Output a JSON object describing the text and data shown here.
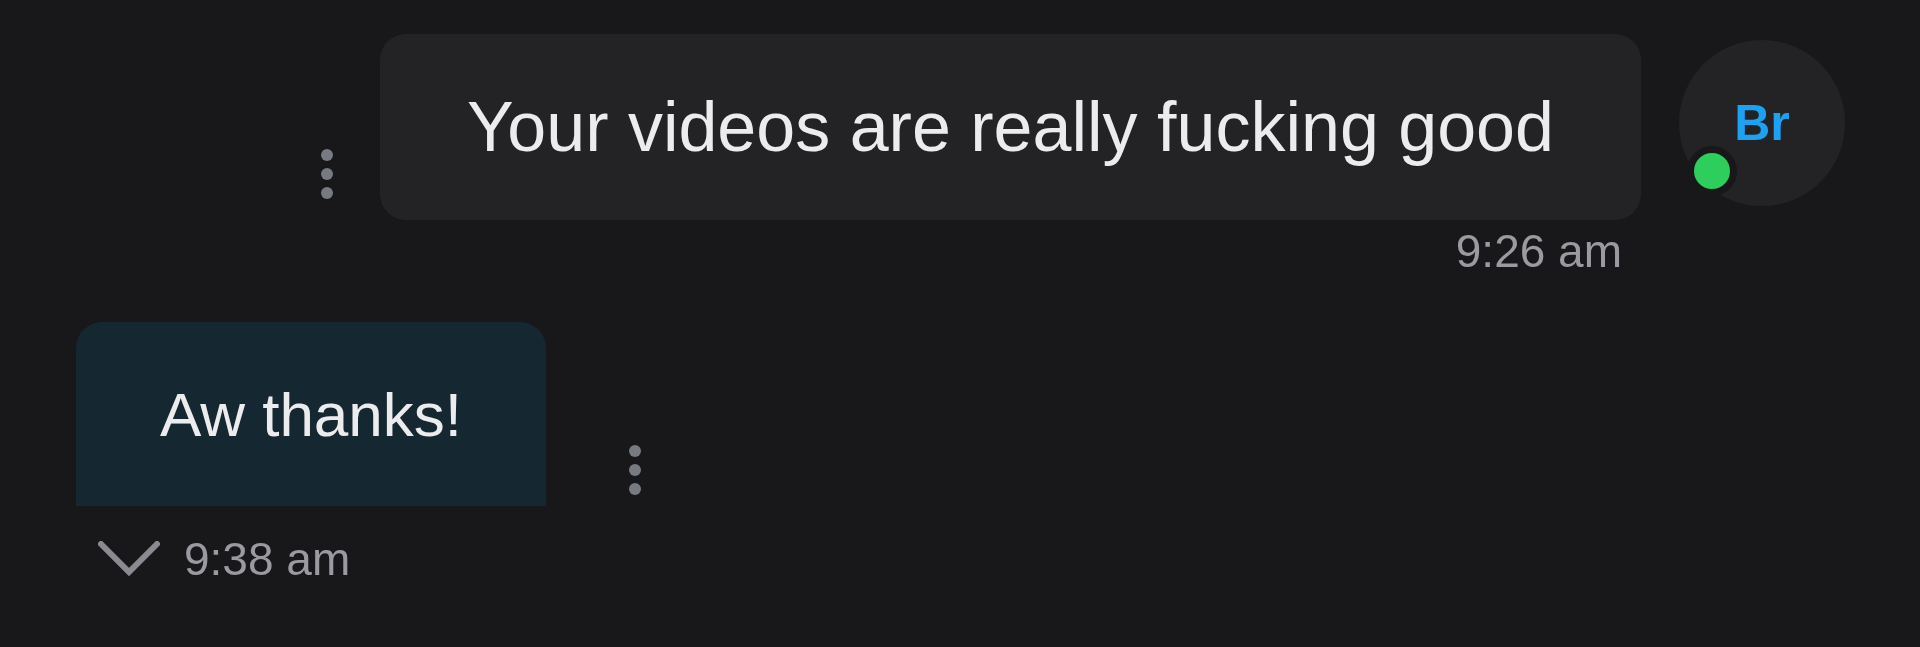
{
  "messages": [
    {
      "kind": "sent",
      "text": "Your videos are really fucking good",
      "time": "9:26 am",
      "avatar": {
        "initials": "Br",
        "online": true
      }
    },
    {
      "kind": "received",
      "text": "Aw thanks!",
      "time": "9:38 am"
    }
  ]
}
